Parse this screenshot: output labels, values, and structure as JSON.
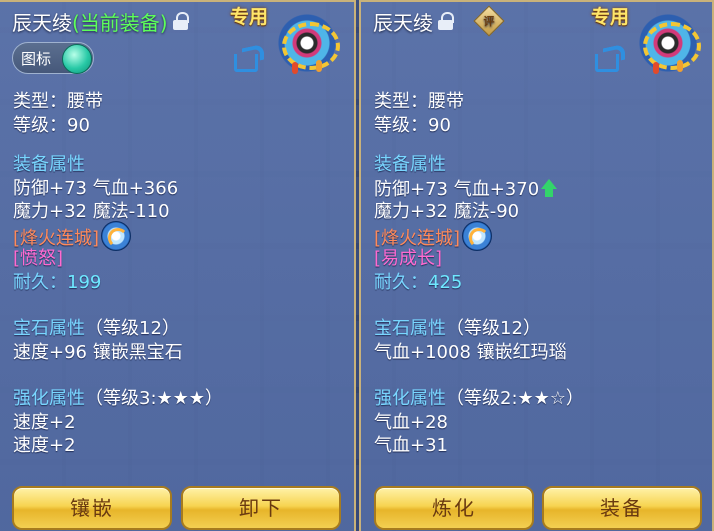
{
  "left_panel": {
    "item_name": "辰天绫",
    "equipped_tag": "(当前装备)",
    "special_label": "专用",
    "toggle_label": "图标",
    "type_line": "类型：腰带",
    "level_line": "等级：90",
    "attr_header": "装备属性",
    "attr_lines": [
      "防御+73 气血+366",
      "魔力+32 魔法-110"
    ],
    "skill_name": "[烽火连城]",
    "effect_name": "[愤怒]",
    "durability_label": "耐久：",
    "durability_value": "199",
    "gem_header": "宝石属性",
    "gem_level": "（等级12）",
    "gem_line": "速度+96 镶嵌黑宝石",
    "enhance_header": "强化属性",
    "enhance_level": "（等级3:★★★）",
    "enhance_lines": [
      "速度+2",
      "速度+2"
    ],
    "buttons": [
      "镶嵌",
      "卸下"
    ]
  },
  "right_panel": {
    "item_name": "辰天绫",
    "rate_badge": "评",
    "special_label": "专用",
    "type_line": "类型：腰带",
    "level_line": "等级：90",
    "attr_header": "装备属性",
    "attr_lines": [
      "防御+73 气血+370",
      "魔力+32 魔法-90"
    ],
    "skill_name": "[烽火连城]",
    "effect_name": "[易成长]",
    "durability_label": "耐久：",
    "durability_value": "425",
    "gem_header": "宝石属性",
    "gem_level": "（等级12）",
    "gem_line": "气血+1008 镶嵌红玛瑙",
    "enhance_header": "强化属性",
    "enhance_level": "（等级2:★★☆）",
    "enhance_lines": [
      "气血+28",
      "气血+31"
    ],
    "buttons": [
      "炼化",
      "装备"
    ]
  },
  "colors": {
    "highlight_green": "#5dff5a",
    "header_blue": "#79d6ff",
    "skill_orange": "#ff8a5a",
    "effect_pink": "#ff6ad0",
    "special_gold": "#ffe66a",
    "button_gold": "#f7d451"
  },
  "icons": [
    "lock-icon",
    "belt-item-icon",
    "share-icon",
    "skill-orb-icon",
    "stat-up-arrow-icon",
    "rating-badge-icon"
  ]
}
